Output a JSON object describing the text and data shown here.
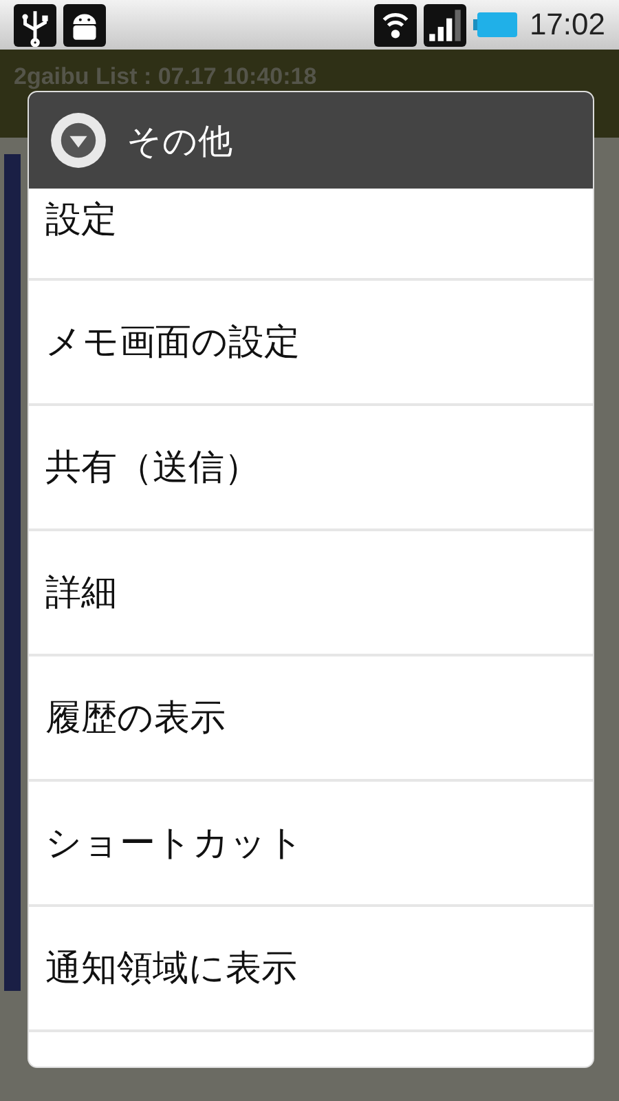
{
  "status_bar": {
    "time": "17:02"
  },
  "app": {
    "title": "2gaibu List : 07.17 10:40:18"
  },
  "dialog": {
    "title": "その他",
    "items": [
      {
        "label": "設定"
      },
      {
        "label": "メモ画面の設定"
      },
      {
        "label": "共有（送信）"
      },
      {
        "label": "詳細"
      },
      {
        "label": "履歴の表示"
      },
      {
        "label": "ショートカット"
      },
      {
        "label": "通知領域に表示"
      }
    ]
  }
}
